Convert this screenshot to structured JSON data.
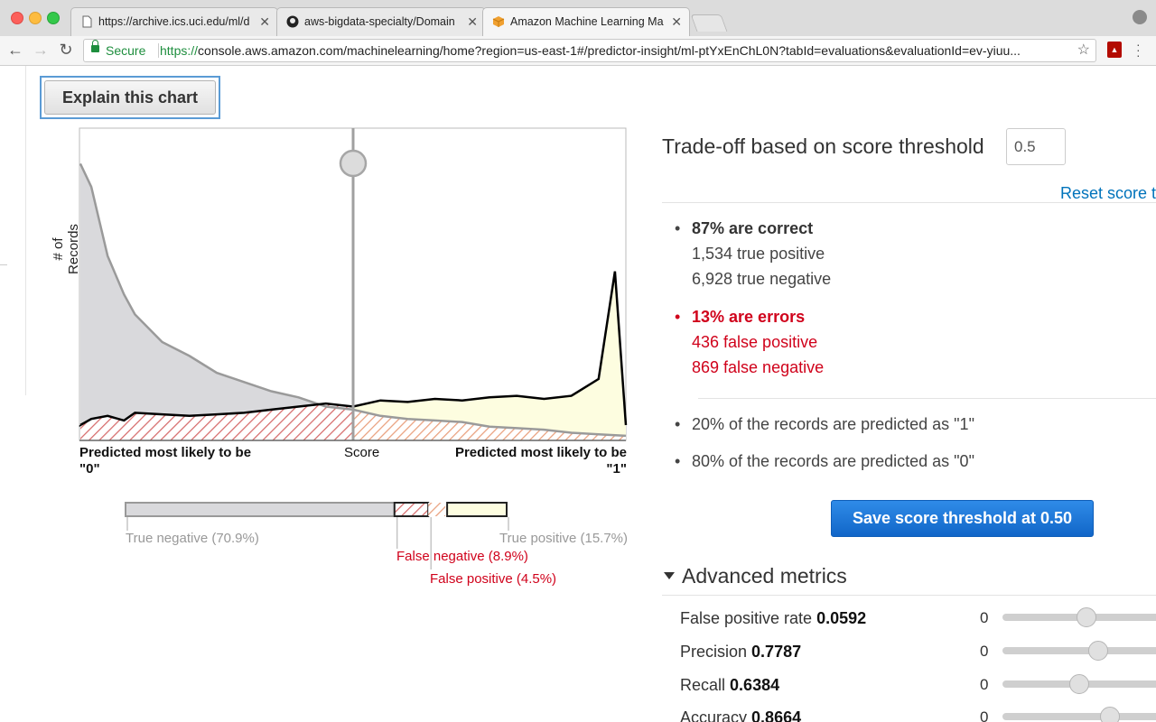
{
  "browser": {
    "tabs": [
      {
        "label": "https://archive.ics.uci.edu/ml/d",
        "active": false
      },
      {
        "label": "aws-bigdata-specialty/Domain",
        "active": false
      },
      {
        "label": "Amazon Machine Learning Ma",
        "active": true
      }
    ],
    "secure_label": "Secure",
    "url_scheme": "https://",
    "url_rest": "console.aws.amazon.com/machinelearning/home?region=us-east-1#/predictor-insight/ml-ptYxEnChL0N?tabId=evaluations&evaluationId=ev-yiuu..."
  },
  "explain_button": "Explain this chart",
  "chart": {
    "y_axis_label": "# of Records",
    "x_left_label": "Predicted most likely to be",
    "x_left_value": "\"0\"",
    "x_mid_label": "Score",
    "x_right_label": "Predicted most likely to be",
    "x_right_value": "\"1\"",
    "threshold": 0.5,
    "legend": {
      "true_negative": "True negative (70.9%)",
      "false_negative": "False negative (8.9%)",
      "false_positive": "False positive (4.5%)",
      "true_positive": "True positive (15.7%)"
    },
    "colors": {
      "negative_fill": "#d9d9dc",
      "positive_fill": "#fdfde0",
      "error_hatch": "#d0021b",
      "curve_positive": "#000000",
      "curve_negative": "#9a9a9a"
    }
  },
  "chart_data": {
    "type": "area",
    "xlabel": "Score",
    "ylabel": "# of Records",
    "xlim": [
      0,
      1
    ],
    "threshold": 0.5,
    "series": [
      {
        "name": "",
        "x": [
          0,
          0.02,
          0.05,
          0.08,
          0.1,
          0.15,
          0.2,
          0.25,
          0.3,
          0.35,
          0.4,
          0.45,
          0.5,
          0.55,
          0.6,
          0.65,
          0.7,
          0.75,
          0.8,
          0.85,
          0.9,
          0.95,
          1.0
        ],
        "values": [
          180,
          165,
          120,
          95,
          82,
          64,
          55,
          44,
          38,
          32,
          28,
          22,
          20,
          16,
          14,
          13,
          12,
          9,
          8,
          7,
          5,
          4,
          3
        ]
      },
      {
        "name": "",
        "x": [
          0,
          0.02,
          0.05,
          0.08,
          0.1,
          0.15,
          0.2,
          0.25,
          0.3,
          0.35,
          0.4,
          0.45,
          0.5,
          0.55,
          0.6,
          0.65,
          0.7,
          0.75,
          0.8,
          0.85,
          0.9,
          0.95,
          0.98,
          1.0
        ],
        "values": [
          10,
          14,
          16,
          13,
          18,
          17,
          16,
          17,
          18,
          20,
          22,
          24,
          22,
          26,
          25,
          27,
          26,
          28,
          29,
          27,
          29,
          40,
          110,
          10
        ]
      }
    ],
    "distribution": [
      {
        "name": "True negative",
        "percent": 70.9
      },
      {
        "name": "False negative",
        "percent": 8.9
      },
      {
        "name": "False positive",
        "percent": 4.5
      },
      {
        "name": "True positive",
        "percent": 15.7
      }
    ]
  },
  "panel": {
    "title": "Trade-off based on score threshold",
    "threshold_value": "0.5",
    "reset_label": "Reset score t",
    "correct_title": "87% are correct",
    "true_positive": "1,534 true positive",
    "true_negative": "6,928 true negative",
    "errors_title": "13% are errors",
    "false_positive": "436 false positive",
    "false_negative": "869 false negative",
    "pred_1": "20% of the records are predicted as \"1\"",
    "pred_0": "80% of the records are predicted as \"0\"",
    "save_button": "Save score threshold at 0.50",
    "advanced_title": "Advanced metrics",
    "metrics": [
      {
        "label": "False positive rate",
        "value": "0.0592",
        "min": "0",
        "level": 0.0592
      },
      {
        "label": "Precision",
        "value": "0.7787",
        "min": "0",
        "level": 0.7787
      },
      {
        "label": "Recall",
        "value": "0.6384",
        "min": "0",
        "level": 0.6384
      },
      {
        "label": "Accuracy",
        "value": "0.8664",
        "min": "0",
        "level": 0.8664
      }
    ]
  }
}
